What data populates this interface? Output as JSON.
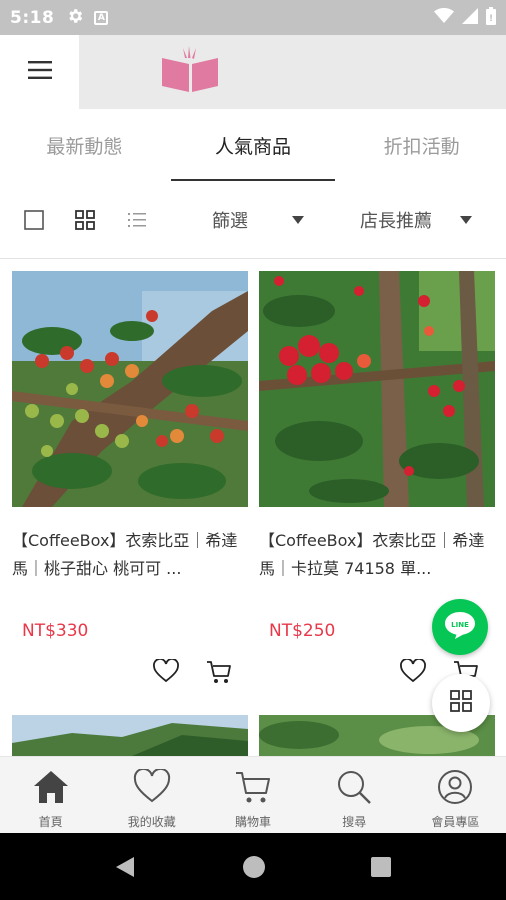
{
  "status_bar": {
    "time": "5:18",
    "icons": [
      "gear-icon",
      "a-notification-icon",
      "wifi-icon",
      "signal-icon",
      "battery-icon"
    ]
  },
  "app_bar": {
    "menu_icon": "hamburger-menu-icon",
    "logo": "pink-book-logo",
    "logo_color": "#e07aa0"
  },
  "tabs": [
    {
      "label": "最新動態",
      "active": false
    },
    {
      "label": "人氣商品",
      "active": true
    },
    {
      "label": "折扣活動",
      "active": false
    }
  ],
  "toolbar": {
    "filter_label": "篩選",
    "sort_label": "店長推薦"
  },
  "products": [
    {
      "title": "【CoffeeBox】衣索比亞｜希達馬｜桃子甜心 桃可可 ...",
      "price": "NT$330"
    },
    {
      "title": "【CoffeeBox】衣索比亞｜希達馬｜卡拉莫 74158 單...",
      "price": "NT$250"
    }
  ],
  "bottom_nav": [
    {
      "label": "首頁",
      "icon": "home-icon"
    },
    {
      "label": "我的收藏",
      "icon": "heart-icon"
    },
    {
      "label": "購物車",
      "icon": "cart-icon"
    },
    {
      "label": "搜尋",
      "icon": "search-icon"
    },
    {
      "label": "會員專區",
      "icon": "user-icon"
    }
  ],
  "colors": {
    "price": "#e8384a",
    "line_green": "#06c755",
    "status_bar": "#c2c2c2"
  }
}
